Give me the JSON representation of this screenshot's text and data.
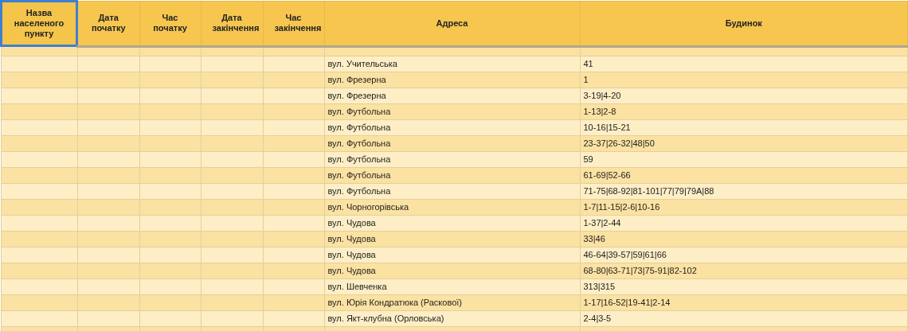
{
  "table": {
    "columns": [
      {
        "label": "Назва населеного пункту",
        "selected": true
      },
      {
        "label": "Дата початку",
        "selected": false
      },
      {
        "label": "Час початку",
        "selected": false
      },
      {
        "label": "Дата закінчення",
        "selected": false
      },
      {
        "label": "Час закінчення",
        "selected": false
      },
      {
        "label": "Адреса",
        "selected": false
      },
      {
        "label": "Будинок",
        "selected": false
      }
    ],
    "rows": [
      {
        "address": "вул. Учительська",
        "building": "41"
      },
      {
        "address": "вул. Фрезерна",
        "building": "1"
      },
      {
        "address": "вул. Фрезерна",
        "building": "3-19|4-20"
      },
      {
        "address": "вул. Футбольна",
        "building": "1-13|2-8"
      },
      {
        "address": "вул. Футбольна",
        "building": "10-16|15-21"
      },
      {
        "address": "вул. Футбольна",
        "building": "23-37|26-32|48|50"
      },
      {
        "address": "вул. Футбольна",
        "building": "59"
      },
      {
        "address": "вул. Футбольна",
        "building": "61-69|52-66"
      },
      {
        "address": "вул. Футбольна",
        "building": "71-75|68-92|81-101|77|79|79A|88"
      },
      {
        "address": "вул. Чорногорівська",
        "building": "1-7|11-15|2-6|10-16"
      },
      {
        "address": "вул. Чудова",
        "building": "1-37|2-44"
      },
      {
        "address": "вул. Чудова",
        "building": "33|46"
      },
      {
        "address": "вул. Чудова",
        "building": "46-64|39-57|59|61|66"
      },
      {
        "address": "вул. Чудова",
        "building": "68-80|63-71|73|75-91|82-102"
      },
      {
        "address": "вул. Шевченка",
        "building": "313|315"
      },
      {
        "address": "вул. Юрія Кондратюка (Раскової)",
        "building": "1-17|16-52|19-41|2-14"
      },
      {
        "address": "вул. Якт-клубна (Орловська)",
        "building": "2-4|3-5"
      }
    ]
  }
}
